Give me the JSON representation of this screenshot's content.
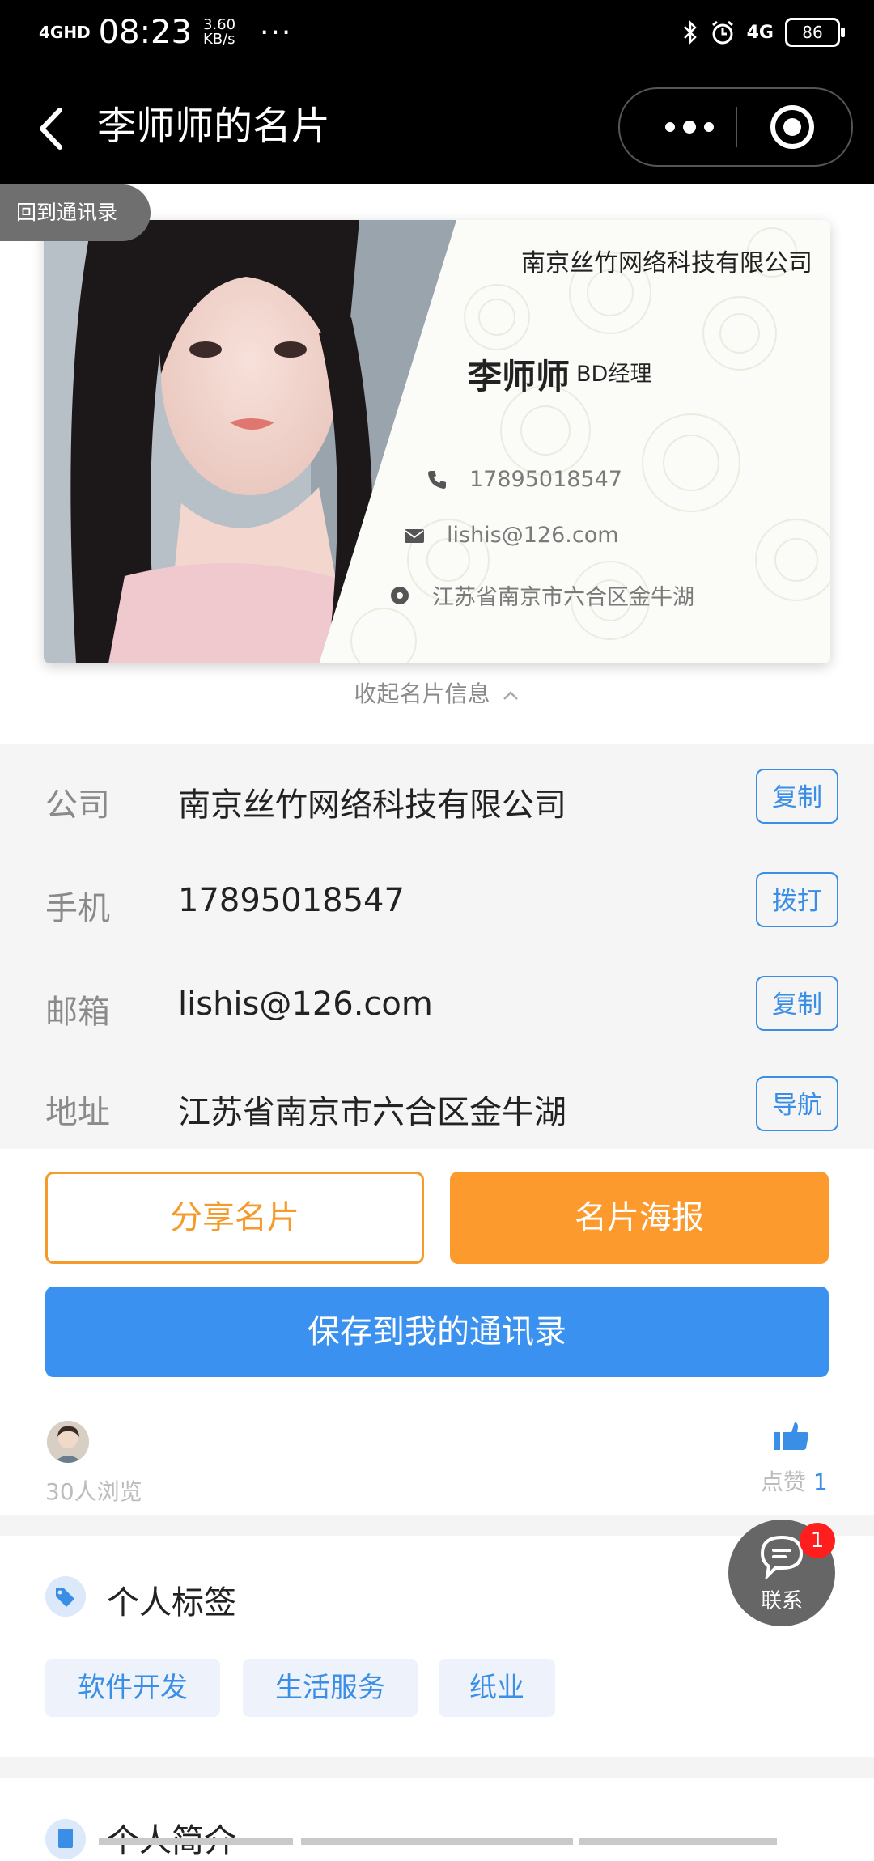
{
  "status_bar": {
    "signal": "4GHD",
    "time": "08:23",
    "speed_value": "3.60",
    "speed_unit": "KB/s",
    "more": "···",
    "network": "4G",
    "battery": "86"
  },
  "nav": {
    "title": "李师师的名片"
  },
  "card": {
    "back_to_contacts": "回到通讯录",
    "company": "南京丝竹网络科技有限公司",
    "name": "李师师",
    "position": "BD经理",
    "phone": "17895018547",
    "email": "lishis@126.com",
    "address": "江苏省南京市六合区金牛湖",
    "collapse": "收起名片信息"
  },
  "info_rows": [
    {
      "label": "公司",
      "value": "南京丝竹网络科技有限公司",
      "action": "复制"
    },
    {
      "label": "手机",
      "value": "17895018547",
      "action": "拨打"
    },
    {
      "label": "邮箱",
      "value": "lishis@126.com",
      "action": "复制"
    },
    {
      "label": "地址",
      "value": "江苏省南京市六合区金牛湖",
      "action": "导航"
    }
  ],
  "actions": {
    "share": "分享名片",
    "poster": "名片海报",
    "save": "保存到我的通讯录"
  },
  "stats": {
    "views": "30人浏览",
    "likes_label": "点赞",
    "likes_count": "1"
  },
  "tags_section": {
    "title": "个人标签",
    "tags": [
      "软件开发",
      "生活服务",
      "纸业"
    ]
  },
  "intro_section": {
    "title": "个人简介"
  },
  "fab": {
    "label": "联系",
    "badge": "1"
  },
  "colors": {
    "accent_blue": "#3a8ee6",
    "accent_orange": "#fc9a2e",
    "save_blue": "#3a91ef",
    "badge_red": "#ff1e1e"
  }
}
